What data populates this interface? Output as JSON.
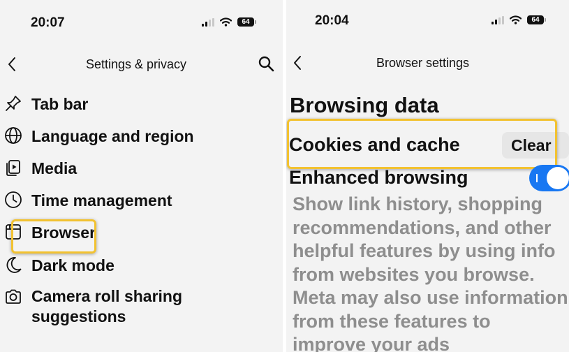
{
  "left": {
    "status": {
      "time": "20:07",
      "battery": "64"
    },
    "header": {
      "title": "Settings & privacy"
    },
    "menu": [
      {
        "label": "Tab bar",
        "icon": "pin-icon"
      },
      {
        "label": "Language and region",
        "icon": "globe-icon"
      },
      {
        "label": "Media",
        "icon": "media-icon"
      },
      {
        "label": "Time management",
        "icon": "clock-icon"
      },
      {
        "label": "Browser",
        "icon": "browser-icon",
        "highlighted": true
      },
      {
        "label": "Dark mode",
        "icon": "moon-icon"
      },
      {
        "label": "Camera roll sharing",
        "label_line2": "suggestions",
        "icon": "camera-icon"
      }
    ]
  },
  "right": {
    "status": {
      "time": "20:04",
      "battery": "64"
    },
    "header": {
      "title": "Browser settings"
    },
    "section_title": "Browsing data",
    "cookies": {
      "label": "Cookies and cache",
      "button": "Clear",
      "highlighted": true
    },
    "enhanced": {
      "label": "Enhanced browsing",
      "toggle_on": true,
      "description": "Show link history, shopping recommendations, and other helpful features by using info from websites you browse. Meta may also use information from these features to improve your ads"
    }
  },
  "colors": {
    "accent": "#1877f2",
    "highlight": "#f2c231",
    "panel_bg": "#f3f3f3",
    "muted_text": "#8e8e8e"
  }
}
